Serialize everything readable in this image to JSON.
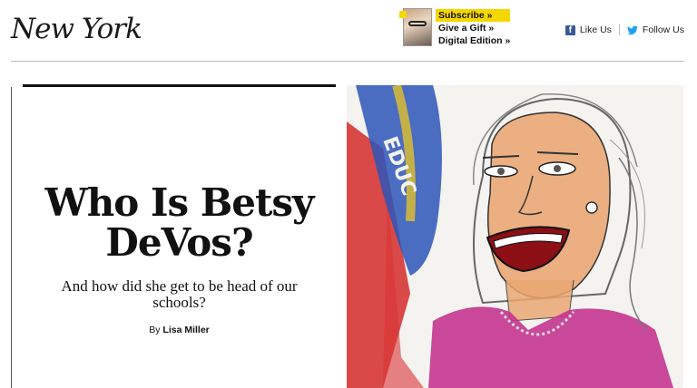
{
  "header": {
    "logo": "New York",
    "promo": {
      "subscribe": "Subscribe »",
      "gift": "Give a Gift »",
      "digital": "Digital Edition »"
    },
    "social": {
      "like": "Like Us",
      "follow": "Follow Us"
    }
  },
  "article": {
    "headline_line1": "Who Is Betsy",
    "headline_line2": "DeVos?",
    "dek": "And how did she get to be head of our schools?",
    "byline_prefix": "By",
    "author": "Lisa Miller"
  },
  "colors": {
    "accent_yellow": "#f5d700",
    "facebook": "#3b5998",
    "twitter": "#1da1f2"
  },
  "icons": [
    "facebook-icon",
    "twitter-icon"
  ]
}
